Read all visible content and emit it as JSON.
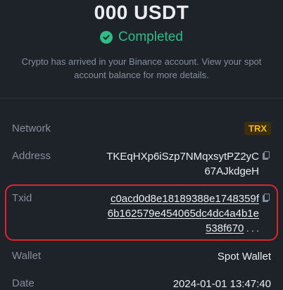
{
  "header": {
    "amount": "000 USDT",
    "status": "Completed",
    "note_line1": "Crypto has arrived in your Binance account. View your spot",
    "note_line2": "account balance for more details."
  },
  "details": {
    "network_label": "Network",
    "network_value": "TRX",
    "address_label": "Address",
    "address_line1": "TKEqHXp6iSzp7NMqxsytPZ2yC",
    "address_line2": "67AJkdgeH",
    "txid_label": "Txid",
    "txid_line1": "c0acd0d8e18189388e1748359f",
    "txid_line2": "6b162579e454065dc4dc4a4b1e",
    "txid_line3": "538f670",
    "txid_line3_tail": " . . .",
    "wallet_label": "Wallet",
    "wallet_value": "Spot Wallet",
    "date_label": "Date",
    "date_value": "2024-01-01 13:47:40"
  },
  "colors": {
    "background": "#1e2329",
    "success": "#2ebd85",
    "muted": "#848e9c",
    "badge_text": "#f0b90b",
    "highlight_border": "#e0242d"
  },
  "icons": {
    "status": "check-circle-icon",
    "copy": "copy-icon"
  }
}
